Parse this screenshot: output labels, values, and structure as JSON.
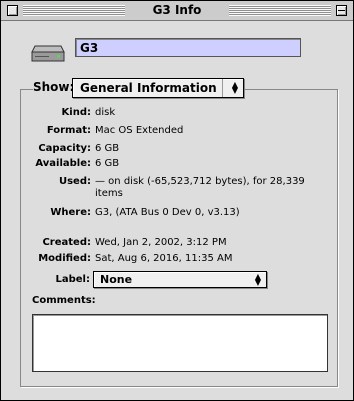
{
  "window": {
    "title": "G3 Info"
  },
  "name_field": {
    "value": "G3"
  },
  "show": {
    "label": "Show:",
    "selected": "General Information"
  },
  "info": [
    {
      "label": "Kind:",
      "value": "disk"
    },
    {
      "label": "Format:",
      "value": "Mac OS Extended"
    },
    {
      "label": "Capacity:",
      "value": "6 GB"
    },
    {
      "label": "Available:",
      "value": "6 GB"
    },
    {
      "label": "Used:",
      "value": "— on disk (-65,523,712 bytes), for 28,339 items"
    },
    {
      "label": "Where:",
      "value": "G3, (ATA Bus 0 Dev 0, v3.13)"
    },
    {
      "label": "Created:",
      "value": "Wed, Jan 2, 2002, 3:12 PM"
    },
    {
      "label": "Modified:",
      "value": "Sat, Aug 6, 2016, 11:35 AM"
    }
  ],
  "label_field": {
    "label": "Label:",
    "selected": "None"
  },
  "comments": {
    "label": "Comments:",
    "value": ""
  },
  "icons": {
    "window_close": "close-box-icon",
    "window_collapse": "collapse-box-icon",
    "disk": "hard-disk-icon",
    "popup": "up-down-arrows-icon"
  },
  "colors": {
    "name_field_highlight": "#cfcfff",
    "window_bg": "#dddddd"
  }
}
